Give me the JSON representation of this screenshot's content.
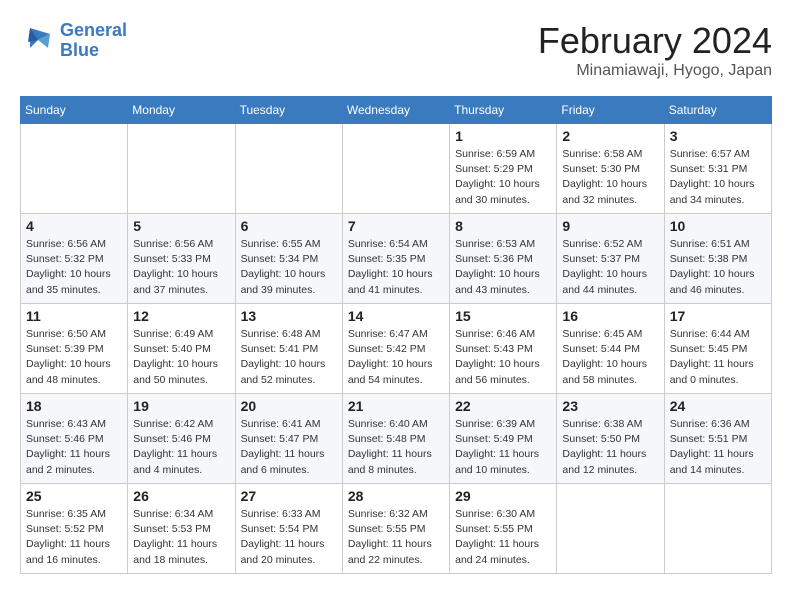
{
  "logo": {
    "line1": "General",
    "line2": "Blue"
  },
  "title": "February 2024",
  "location": "Minamiawaji, Hyogo, Japan",
  "days_of_week": [
    "Sunday",
    "Monday",
    "Tuesday",
    "Wednesday",
    "Thursday",
    "Friday",
    "Saturday"
  ],
  "weeks": [
    [
      {
        "day": "",
        "info": ""
      },
      {
        "day": "",
        "info": ""
      },
      {
        "day": "",
        "info": ""
      },
      {
        "day": "",
        "info": ""
      },
      {
        "day": "1",
        "info": "Sunrise: 6:59 AM\nSunset: 5:29 PM\nDaylight: 10 hours and 30 minutes."
      },
      {
        "day": "2",
        "info": "Sunrise: 6:58 AM\nSunset: 5:30 PM\nDaylight: 10 hours and 32 minutes."
      },
      {
        "day": "3",
        "info": "Sunrise: 6:57 AM\nSunset: 5:31 PM\nDaylight: 10 hours and 34 minutes."
      }
    ],
    [
      {
        "day": "4",
        "info": "Sunrise: 6:56 AM\nSunset: 5:32 PM\nDaylight: 10 hours and 35 minutes."
      },
      {
        "day": "5",
        "info": "Sunrise: 6:56 AM\nSunset: 5:33 PM\nDaylight: 10 hours and 37 minutes."
      },
      {
        "day": "6",
        "info": "Sunrise: 6:55 AM\nSunset: 5:34 PM\nDaylight: 10 hours and 39 minutes."
      },
      {
        "day": "7",
        "info": "Sunrise: 6:54 AM\nSunset: 5:35 PM\nDaylight: 10 hours and 41 minutes."
      },
      {
        "day": "8",
        "info": "Sunrise: 6:53 AM\nSunset: 5:36 PM\nDaylight: 10 hours and 43 minutes."
      },
      {
        "day": "9",
        "info": "Sunrise: 6:52 AM\nSunset: 5:37 PM\nDaylight: 10 hours and 44 minutes."
      },
      {
        "day": "10",
        "info": "Sunrise: 6:51 AM\nSunset: 5:38 PM\nDaylight: 10 hours and 46 minutes."
      }
    ],
    [
      {
        "day": "11",
        "info": "Sunrise: 6:50 AM\nSunset: 5:39 PM\nDaylight: 10 hours and 48 minutes."
      },
      {
        "day": "12",
        "info": "Sunrise: 6:49 AM\nSunset: 5:40 PM\nDaylight: 10 hours and 50 minutes."
      },
      {
        "day": "13",
        "info": "Sunrise: 6:48 AM\nSunset: 5:41 PM\nDaylight: 10 hours and 52 minutes."
      },
      {
        "day": "14",
        "info": "Sunrise: 6:47 AM\nSunset: 5:42 PM\nDaylight: 10 hours and 54 minutes."
      },
      {
        "day": "15",
        "info": "Sunrise: 6:46 AM\nSunset: 5:43 PM\nDaylight: 10 hours and 56 minutes."
      },
      {
        "day": "16",
        "info": "Sunrise: 6:45 AM\nSunset: 5:44 PM\nDaylight: 10 hours and 58 minutes."
      },
      {
        "day": "17",
        "info": "Sunrise: 6:44 AM\nSunset: 5:45 PM\nDaylight: 11 hours and 0 minutes."
      }
    ],
    [
      {
        "day": "18",
        "info": "Sunrise: 6:43 AM\nSunset: 5:46 PM\nDaylight: 11 hours and 2 minutes."
      },
      {
        "day": "19",
        "info": "Sunrise: 6:42 AM\nSunset: 5:46 PM\nDaylight: 11 hours and 4 minutes."
      },
      {
        "day": "20",
        "info": "Sunrise: 6:41 AM\nSunset: 5:47 PM\nDaylight: 11 hours and 6 minutes."
      },
      {
        "day": "21",
        "info": "Sunrise: 6:40 AM\nSunset: 5:48 PM\nDaylight: 11 hours and 8 minutes."
      },
      {
        "day": "22",
        "info": "Sunrise: 6:39 AM\nSunset: 5:49 PM\nDaylight: 11 hours and 10 minutes."
      },
      {
        "day": "23",
        "info": "Sunrise: 6:38 AM\nSunset: 5:50 PM\nDaylight: 11 hours and 12 minutes."
      },
      {
        "day": "24",
        "info": "Sunrise: 6:36 AM\nSunset: 5:51 PM\nDaylight: 11 hours and 14 minutes."
      }
    ],
    [
      {
        "day": "25",
        "info": "Sunrise: 6:35 AM\nSunset: 5:52 PM\nDaylight: 11 hours and 16 minutes."
      },
      {
        "day": "26",
        "info": "Sunrise: 6:34 AM\nSunset: 5:53 PM\nDaylight: 11 hours and 18 minutes."
      },
      {
        "day": "27",
        "info": "Sunrise: 6:33 AM\nSunset: 5:54 PM\nDaylight: 11 hours and 20 minutes."
      },
      {
        "day": "28",
        "info": "Sunrise: 6:32 AM\nSunset: 5:55 PM\nDaylight: 11 hours and 22 minutes."
      },
      {
        "day": "29",
        "info": "Sunrise: 6:30 AM\nSunset: 5:55 PM\nDaylight: 11 hours and 24 minutes."
      },
      {
        "day": "",
        "info": ""
      },
      {
        "day": "",
        "info": ""
      }
    ]
  ]
}
